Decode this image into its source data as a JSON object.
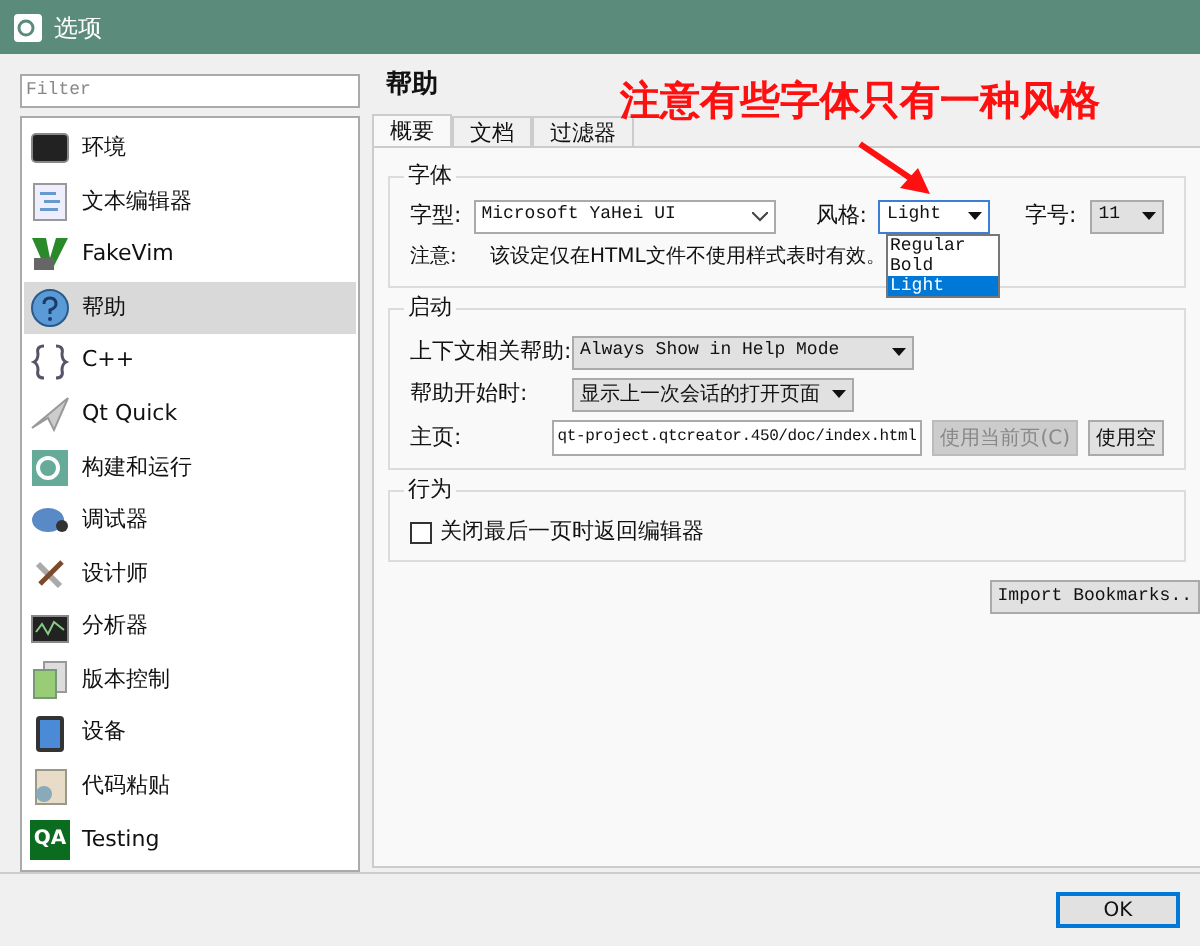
{
  "window": {
    "title": "选项"
  },
  "sidebar": {
    "filter_placeholder": "Filter",
    "items": [
      {
        "label": "环境",
        "selected": false
      },
      {
        "label": "文本编辑器",
        "selected": false
      },
      {
        "label": "FakeVim",
        "selected": false
      },
      {
        "label": "帮助",
        "selected": true
      },
      {
        "label": "C++",
        "selected": false
      },
      {
        "label": "Qt Quick",
        "selected": false
      },
      {
        "label": "构建和运行",
        "selected": false
      },
      {
        "label": "调试器",
        "selected": false
      },
      {
        "label": "设计师",
        "selected": false
      },
      {
        "label": "分析器",
        "selected": false
      },
      {
        "label": "版本控制",
        "selected": false
      },
      {
        "label": "设备",
        "selected": false
      },
      {
        "label": "代码粘贴",
        "selected": false
      },
      {
        "label": "Testing",
        "selected": false,
        "badge": "QA"
      }
    ]
  },
  "page": {
    "title": "帮助",
    "tabs": [
      {
        "label": "概要",
        "selected": true
      },
      {
        "label": "文档",
        "selected": false
      },
      {
        "label": "过滤器",
        "selected": false
      }
    ],
    "font_group": {
      "title": "字体",
      "family_label": "字型:",
      "family_value": "Microsoft YaHei UI",
      "style_label": "风格:",
      "style_value": "Light",
      "style_options": [
        {
          "label": "Regular",
          "selected": false
        },
        {
          "label": "Bold",
          "selected": false
        },
        {
          "label": "Light",
          "selected": true
        }
      ],
      "size_label": "字号:",
      "size_value": "11",
      "note_label": "注意:",
      "note": "该设定仅在HTML文件不使用样式表时有效。"
    },
    "startup_group": {
      "title": "启动",
      "context_help_label": "上下文相关帮助:",
      "context_help_value": "Always Show in Help Mode",
      "on_start_label": "帮助开始时:",
      "on_start_value": "显示上一次会话的打开页面",
      "home_label": "主页:",
      "home_value": "qt-project.qtcreator.450/doc/index.html",
      "buttons": [
        {
          "label": "使用当前页(C)",
          "disabled": true
        },
        {
          "label": "使用空",
          "disabled": false
        }
      ]
    },
    "behavior_group": {
      "title": "行为",
      "checkbox": {
        "label": "关闭最后一页时返回编辑器",
        "checked": false
      }
    },
    "import_button": "Import Bookmarks.."
  },
  "footer": {
    "buttons": [
      {
        "label": "OK",
        "focused": true
      }
    ]
  },
  "annotation": {
    "text": "注意有些字体只有一种风格"
  }
}
